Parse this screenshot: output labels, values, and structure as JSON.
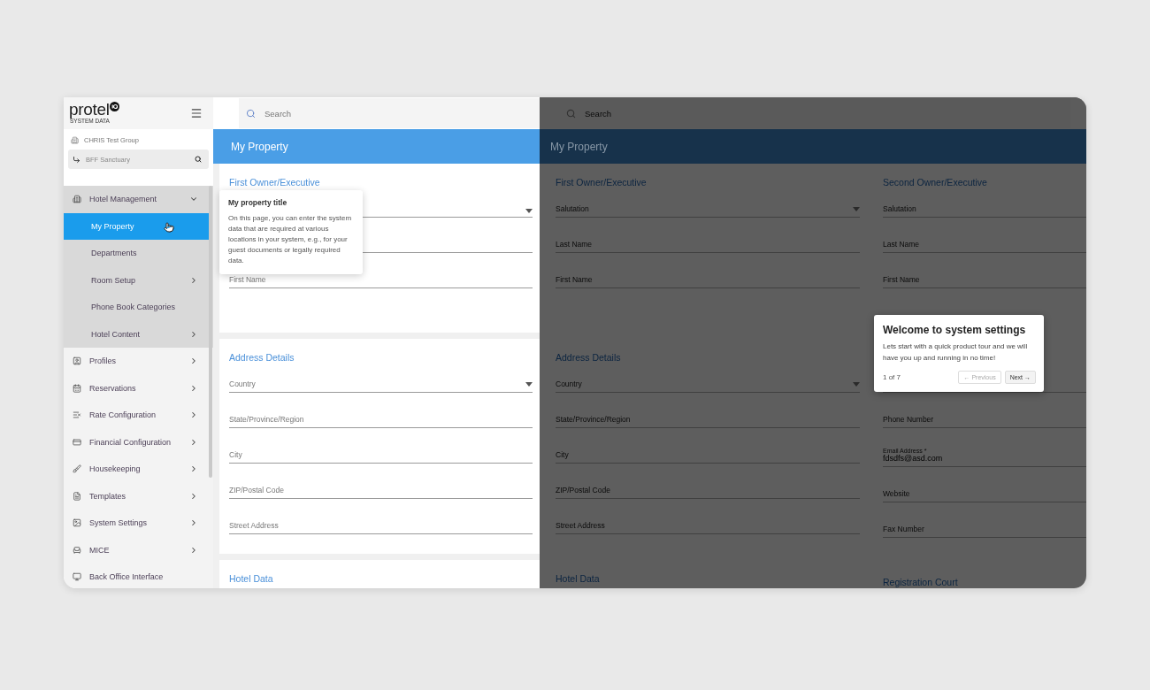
{
  "sidebar": {
    "logo": "protel",
    "logo_subtitle": "SYSTEM DATA",
    "group": "CHRIS Test Group",
    "property": "BFF Sanctuary",
    "menu": [
      {
        "label": "Hotel Management",
        "kind": "building",
        "has_submenu": true,
        "expanded": true,
        "children": [
          {
            "label": "My Property",
            "selected": true,
            "has_submenu": false
          },
          {
            "label": "Departments",
            "selected": false,
            "has_submenu": false
          },
          {
            "label": "Room Setup",
            "selected": false,
            "has_submenu": true
          },
          {
            "label": "Phone Book Categories",
            "selected": false,
            "has_submenu": false
          },
          {
            "label": "Hotel Content",
            "selected": false,
            "has_submenu": true
          }
        ]
      },
      {
        "label": "Profiles",
        "kind": "profile",
        "has_submenu": true,
        "expanded": false
      },
      {
        "label": "Reservations",
        "kind": "calendar",
        "has_submenu": true,
        "expanded": false
      },
      {
        "label": "Rate Configuration",
        "kind": "rate",
        "has_submenu": true,
        "expanded": false
      },
      {
        "label": "Financial Configuration",
        "kind": "finance",
        "has_submenu": true,
        "expanded": false
      },
      {
        "label": "Housekeeping",
        "kind": "brush",
        "has_submenu": true,
        "expanded": false
      },
      {
        "label": "Templates",
        "kind": "document",
        "has_submenu": true,
        "expanded": false
      },
      {
        "label": "System Settings",
        "kind": "settings",
        "has_submenu": true,
        "expanded": false
      },
      {
        "label": "MICE",
        "kind": "mice",
        "has_submenu": true,
        "expanded": false
      },
      {
        "label": "Back Office Interface",
        "kind": "monitor",
        "has_submenu": false,
        "expanded": false
      }
    ]
  },
  "main": {
    "search_placeholder": "Search",
    "title": "My Property",
    "sections": [
      {
        "heading": "First Owner/Executive",
        "fields": [
          {
            "kind": "select"
          },
          {
            "kind": "text"
          },
          {
            "kind": "text",
            "label": "First Name"
          }
        ]
      },
      {
        "heading": "Address Details",
        "fields": [
          {
            "kind": "select",
            "label": "Country"
          },
          {
            "kind": "text",
            "label": "State/Province/Region"
          },
          {
            "kind": "text",
            "label": "City"
          },
          {
            "kind": "text",
            "label": "ZIP/Postal Code"
          },
          {
            "kind": "text",
            "label": "Street Address"
          }
        ]
      },
      {
        "heading": "Hotel Data"
      }
    ],
    "tooltip": {
      "title": "My property title",
      "text": "On this page, you can enter the system data that are required at various locations in your system, e.g., for your guest documents or legally required data."
    }
  },
  "overlay_view": {
    "search_placeholder": "Search",
    "title": "My Property",
    "columns": [
      {
        "sections": [
          {
            "heading": "First Owner/Executive",
            "fields": [
              {
                "kind": "select",
                "label": "Salutation"
              },
              {
                "kind": "text",
                "label": "Last Name"
              },
              {
                "kind": "text",
                "label": "First Name"
              }
            ]
          },
          {
            "heading": "Address Details",
            "fields": [
              {
                "kind": "select",
                "label": "Country"
              },
              {
                "kind": "text",
                "label": "State/Province/Region"
              },
              {
                "kind": "text",
                "label": "City"
              },
              {
                "kind": "text",
                "label": "ZIP/Postal Code"
              },
              {
                "kind": "text",
                "label": "Street Address"
              }
            ]
          },
          {
            "heading": "Hotel Data"
          }
        ]
      },
      {
        "sections": [
          {
            "heading": "Second Owner/Executive",
            "fields": [
              {
                "kind": "text",
                "label": "Salutation"
              },
              {
                "kind": "text",
                "label": "Last Name"
              },
              {
                "kind": "text",
                "label": "First Name"
              }
            ]
          },
          {
            "fields": [
              {
                "kind": "text"
              },
              {
                "kind": "text",
                "label": "Phone Number"
              },
              {
                "kind": "text",
                "label": "Email Address *",
                "value": "fdsdfs@asd.com"
              },
              {
                "kind": "text",
                "label": "Website"
              },
              {
                "kind": "text",
                "label": "Fax Number"
              }
            ]
          },
          {
            "heading": "Registration Court"
          }
        ]
      }
    ],
    "tour": {
      "title": "Welcome to system settings",
      "text": "Lets start with a quick product tour and we will have you up and running in no time!",
      "counter": "1 of 7",
      "previous": {
        "label": "← Previous",
        "disabled": true
      },
      "next": {
        "label": "Next →",
        "disabled": false
      }
    }
  }
}
